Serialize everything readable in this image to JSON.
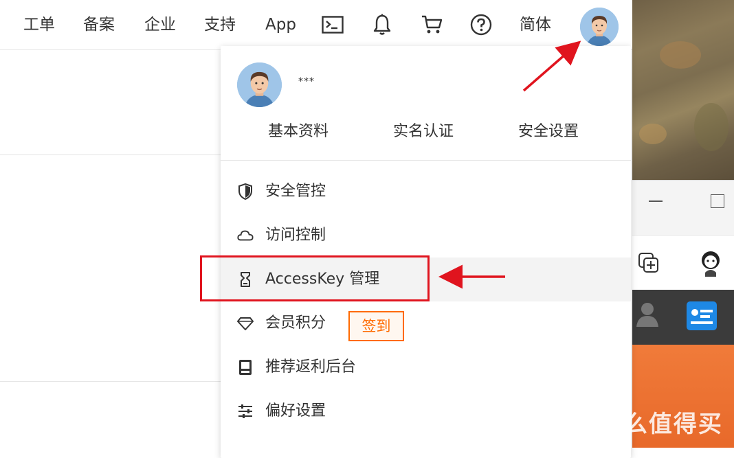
{
  "topbar": {
    "items": [
      {
        "label": "工单"
      },
      {
        "label": "备案"
      },
      {
        "label": "企业"
      },
      {
        "label": "支持"
      },
      {
        "label": "App"
      }
    ],
    "lang_label": "简体"
  },
  "user": {
    "name": "***"
  },
  "quick_links": [
    "基本资料",
    "实名认证",
    "安全设置"
  ],
  "menu": {
    "items": [
      {
        "label": "安全管控",
        "icon": "shield-icon"
      },
      {
        "label": "访问控制",
        "icon": "cloud-icon"
      },
      {
        "label": "AccessKey 管理",
        "icon": "key-icon"
      },
      {
        "label": "会员积分",
        "icon": "diamond-icon"
      },
      {
        "label": "推荐返利后台",
        "icon": "book-icon"
      },
      {
        "label": "偏好设置",
        "icon": "sliders-icon"
      }
    ],
    "checkin_label": "签到"
  },
  "watermark": "值 什么值得买",
  "colors": {
    "accent": "#ff6a00",
    "annotation": "#e0141e"
  }
}
